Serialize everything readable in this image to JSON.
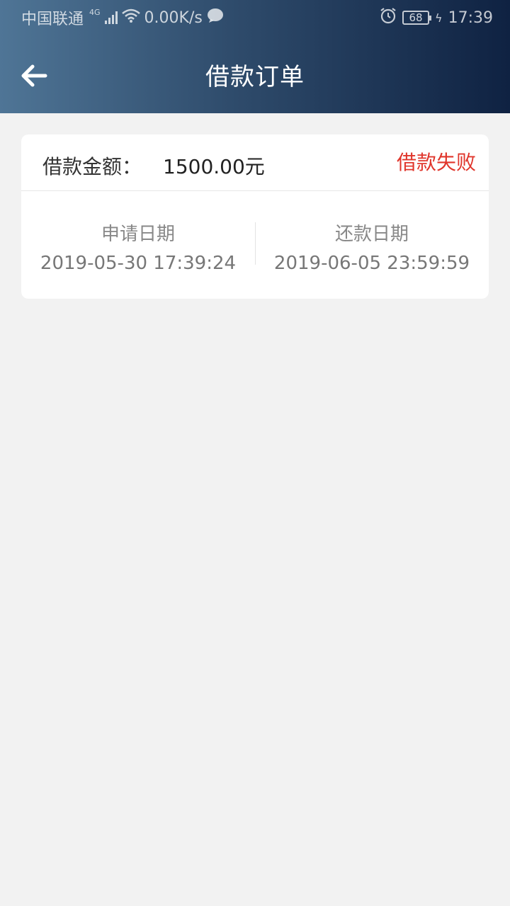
{
  "status_bar": {
    "carrier": "中国联通",
    "network_type": "4G",
    "net_speed": "0.00K/s",
    "battery": "68",
    "time": "17:39"
  },
  "nav": {
    "title": "借款订单"
  },
  "order": {
    "amount_label": "借款金额：",
    "amount_value": "1500.00元",
    "status": "借款失败",
    "apply_date_label": "申请日期",
    "apply_date_value": "2019-05-30 17:39:24",
    "repay_date_label": "还款日期",
    "repay_date_value": "2019-06-05 23:59:59"
  },
  "colors": {
    "header_start": "#4f7596",
    "header_end": "#0f2242",
    "status_red": "#e0352b",
    "background": "#f2f2f2"
  }
}
